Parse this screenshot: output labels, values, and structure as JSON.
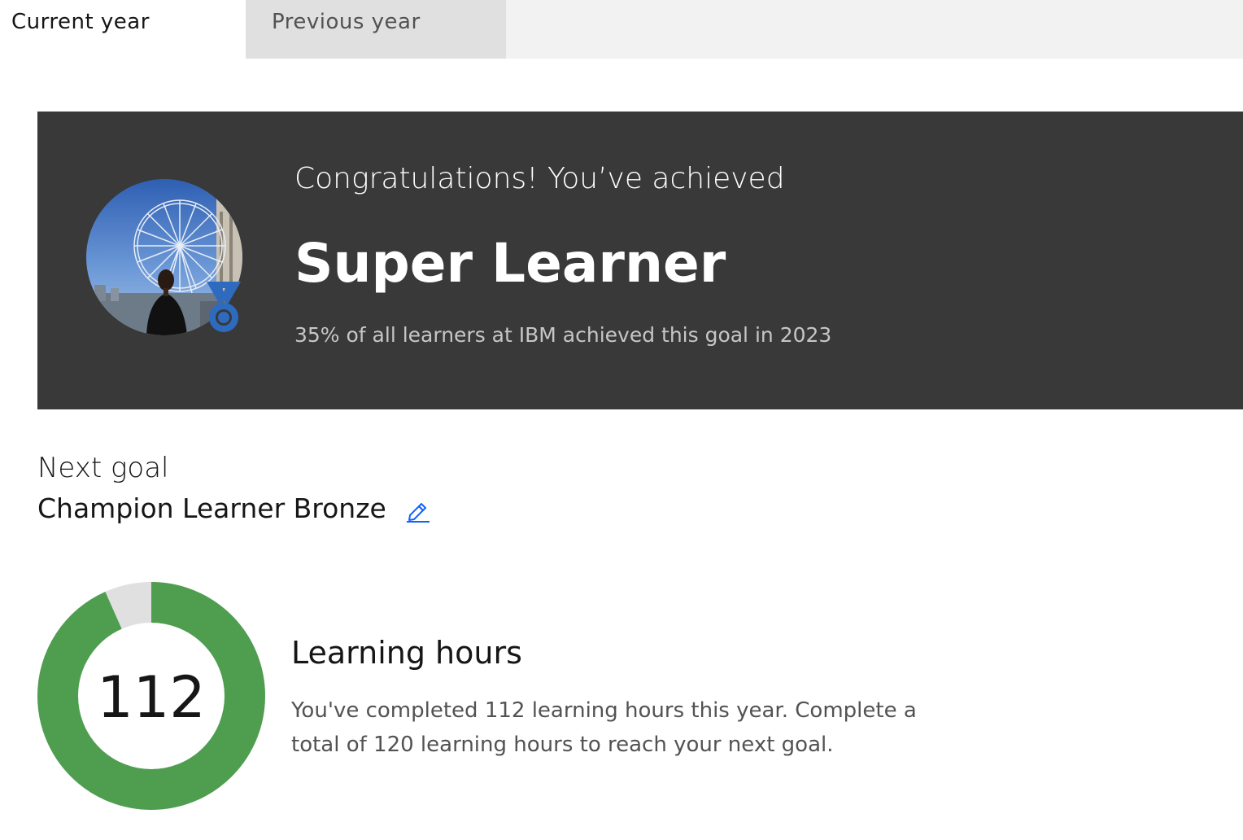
{
  "tabs": {
    "current": "Current year",
    "previous": "Previous year"
  },
  "banner": {
    "congrats": "Congratulations! You’ve achieved",
    "achievement": "Super Learner",
    "stat": "35% of all learners at IBM achieved this goal in 2023"
  },
  "next_goal": {
    "label": "Next goal",
    "value": "Champion Learner Bronze",
    "edit_icon": "pencil-edit-icon"
  },
  "learning_hours": {
    "completed": 112,
    "target": 120,
    "completed_display": "112",
    "title": "Learning hours",
    "description": "You've completed 112 learning hours this year. Complete a total of 120 learning hours to reach your next goal."
  },
  "colors": {
    "banner_bg": "#393939",
    "progress_green": "#4f9e4f",
    "progress_track": "#e0e0e0",
    "medal_blue": "#2e6bbf",
    "link_blue": "#0f62fe"
  }
}
